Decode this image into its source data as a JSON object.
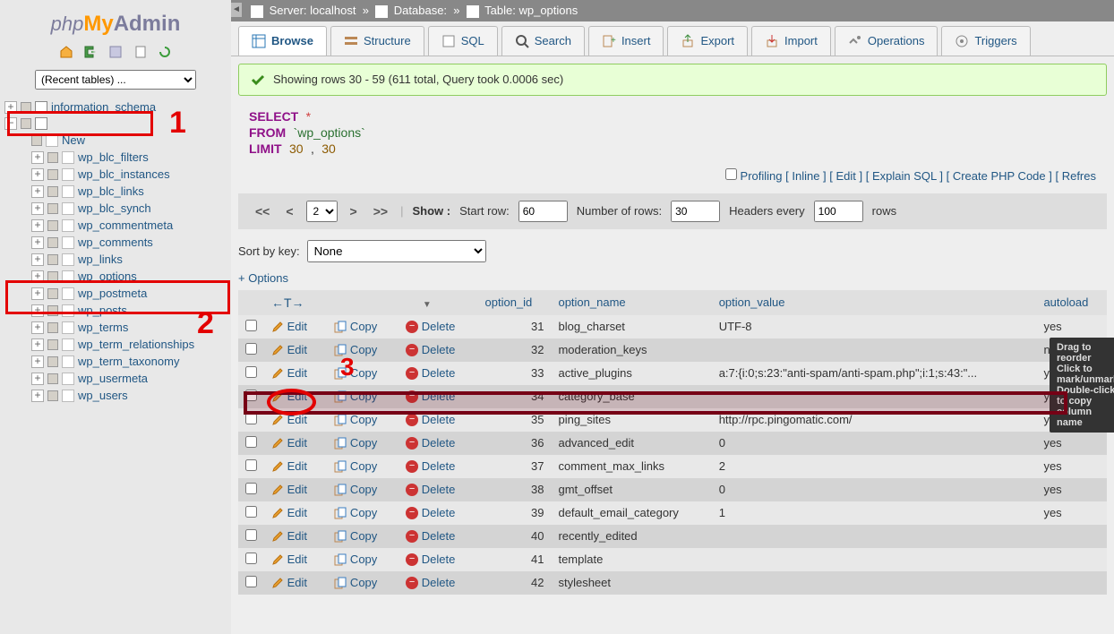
{
  "breadcrumb": {
    "server_label": "Server:",
    "server_value": "localhost",
    "database_label": "Database:",
    "database_value": "",
    "table_label": "Table:",
    "table_value": "wp_options"
  },
  "recent_tables_placeholder": "(Recent tables) ...",
  "tree": {
    "top": "information_schema",
    "selected_db": "",
    "tables": [
      "New",
      "wp_blc_filters",
      "wp_blc_instances",
      "wp_blc_links",
      "wp_blc_synch",
      "wp_commentmeta",
      "wp_comments",
      "wp_links",
      "wp_options",
      "wp_postmeta",
      "wp_posts",
      "wp_terms",
      "wp_term_relationships",
      "wp_term_taxonomy",
      "wp_usermeta",
      "wp_users"
    ]
  },
  "tabs": {
    "browse": "Browse",
    "structure": "Structure",
    "sql": "SQL",
    "search": "Search",
    "insert": "Insert",
    "export": "Export",
    "import": "Import",
    "operations": "Operations",
    "triggers": "Triggers"
  },
  "success_msg": "Showing rows 30 - 59 (611 total, Query took 0.0006 sec)",
  "query": {
    "select": "SELECT",
    "star": "*",
    "from": "FROM",
    "table": "`wp_options`",
    "limit": "LIMIT",
    "num1": "30",
    "comma": ",",
    "num2": "30"
  },
  "sql_links": {
    "profiling": "Profiling",
    "inline": "Inline",
    "edit": "Edit",
    "explain": "Explain SQL",
    "php": "Create PHP Code",
    "refresh": "Refres"
  },
  "nav": {
    "page": "2",
    "show_label": "Show :",
    "start_label": "Start row:",
    "start_val": "60",
    "numrows_label": "Number of rows:",
    "numrows_val": "30",
    "headers_label": "Headers every",
    "headers_val": "100",
    "rows_label": "rows"
  },
  "sort_label": "Sort by key:",
  "sort_value": "None",
  "options_link": "+ Options",
  "headers": {
    "arrow": "←T→",
    "option_id": "option_id",
    "option_name": "option_name",
    "option_value": "option_value",
    "autoload": "autoload"
  },
  "actions": {
    "edit": "Edit",
    "copy": "Copy",
    "delete": "Delete"
  },
  "rows": [
    {
      "id": "31",
      "name": "blog_charset",
      "value": "UTF-8",
      "autoload": "yes"
    },
    {
      "id": "32",
      "name": "moderation_keys",
      "value": "",
      "autoload": "no"
    },
    {
      "id": "33",
      "name": "active_plugins",
      "value": "a:7:{i:0;s:23:\"anti-spam/anti-spam.php\";i:1;s:43:\"...",
      "autoload": "yes"
    },
    {
      "id": "34",
      "name": "category_base",
      "value": "",
      "autoload": "yes"
    },
    {
      "id": "35",
      "name": "ping_sites",
      "value": "http://rpc.pingomatic.com/",
      "autoload": "yes"
    },
    {
      "id": "36",
      "name": "advanced_edit",
      "value": "0",
      "autoload": "yes"
    },
    {
      "id": "37",
      "name": "comment_max_links",
      "value": "2",
      "autoload": "yes"
    },
    {
      "id": "38",
      "name": "gmt_offset",
      "value": "0",
      "autoload": "yes"
    },
    {
      "id": "39",
      "name": "default_email_category",
      "value": "1",
      "autoload": "yes"
    },
    {
      "id": "40",
      "name": "recently_edited",
      "value": "",
      "autoload": ""
    },
    {
      "id": "41",
      "name": "template",
      "value": "",
      "autoload": ""
    },
    {
      "id": "42",
      "name": "stylesheet",
      "value": "",
      "autoload": ""
    }
  ],
  "tooltip": {
    "l1": "Drag to reorder",
    "l2": "Click to mark/unmark",
    "l3": "Double-click to copy column name"
  },
  "annot": {
    "n1": "1",
    "n2": "2",
    "n3": "3"
  }
}
